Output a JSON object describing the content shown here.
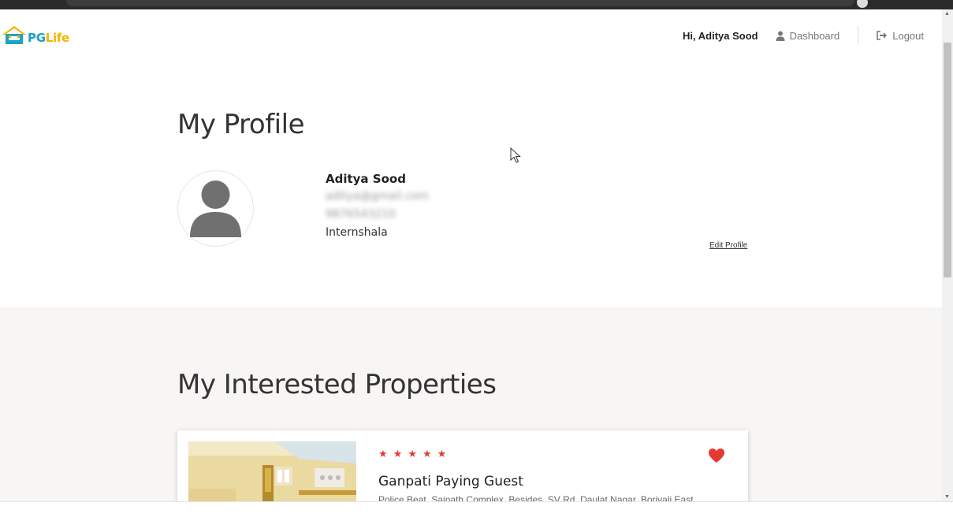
{
  "navbar": {
    "logo": {
      "pg": "PG",
      "life": "Life"
    },
    "greeting": "Hi, Aditya Sood",
    "dashboard_label": "Dashboard",
    "logout_label": "Logout",
    "dashboard_icon": "user-icon",
    "logout_icon": "sign-out-icon"
  },
  "profile": {
    "title": "My Profile",
    "name": "Aditya Sood",
    "email": "aditya@gmail.com",
    "phone": "9876543210",
    "college": "Internshala",
    "edit_label": "Edit Profile",
    "avatar_icon": "user-avatar-icon"
  },
  "interested": {
    "title": "My Interested Properties",
    "properties": [
      {
        "name": "Ganpati Paying Guest",
        "address": "Police Beat, Sainath Complex, Besides, SV Rd, Daulat Nagar, Borivali East",
        "rating_stars": 5,
        "liked": true
      }
    ]
  },
  "colors": {
    "brand_blue": "#1aa3c2",
    "brand_yellow": "#f4b400",
    "star_red": "#e53935",
    "heart_red": "#e53935",
    "section_bg": "#f8f6f4"
  }
}
